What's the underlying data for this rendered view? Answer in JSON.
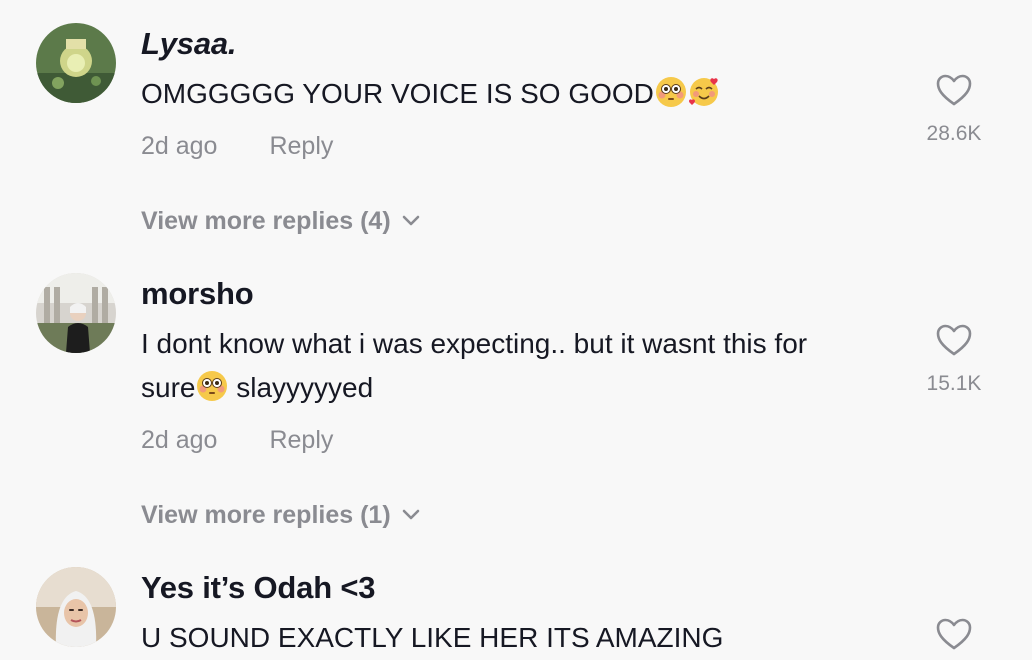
{
  "comments": [
    {
      "username": "Lysaa.",
      "text": "OMGGGGG YOUR VOICE IS SO GOOD",
      "emojis": [
        "flushed-face",
        "smiling-face-with-hearts"
      ],
      "time": "2d ago",
      "reply_label": "Reply",
      "likes": "28.6K",
      "view_more": "View more replies (4)"
    },
    {
      "username": "morsho",
      "text_line1": "I dont know what i was expecting.. but it wasnt this for",
      "text_line2_a": "sure",
      "text_line2_b": " slayyyyyed",
      "emojis": [
        "flushed-face"
      ],
      "time": "2d ago",
      "reply_label": "Reply",
      "likes": "15.1K",
      "view_more": "View more replies (1)"
    },
    {
      "username": "Yes it’s Odah <3",
      "text": "U SOUND EXACTLY LIKE HER ITS AMAZING"
    }
  ],
  "colors": {
    "background": "#f8f8f8",
    "primary_text": "#161823",
    "secondary_text": "#8a8b91"
  },
  "icons": {
    "like": "heart-outline-icon",
    "expand": "chevron-down-icon"
  }
}
